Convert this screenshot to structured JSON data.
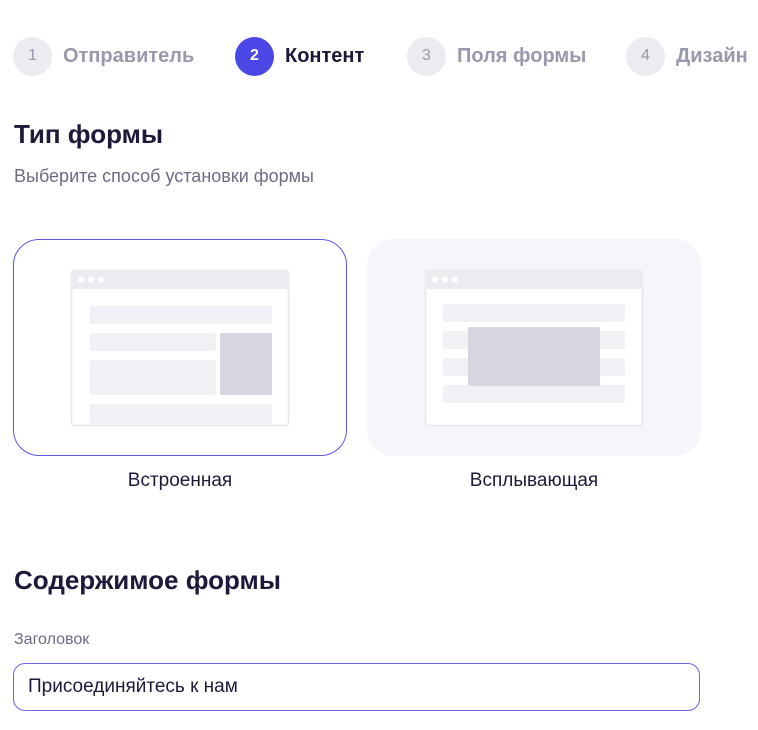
{
  "steps": [
    {
      "number": "1",
      "label": "Отправитель"
    },
    {
      "number": "2",
      "label": "Контент"
    },
    {
      "number": "3",
      "label": "Поля формы"
    },
    {
      "number": "4",
      "label": "Дизайн"
    }
  ],
  "active_step": 2,
  "form_type": {
    "title": "Тип формы",
    "subtitle": "Выберите способ установки формы",
    "options": [
      {
        "label": "Встроенная",
        "selected": true,
        "illustration": "embedded-form-icon"
      },
      {
        "label": "Всплывающая",
        "selected": false,
        "illustration": "popup-form-icon"
      }
    ]
  },
  "form_content": {
    "title": "Содержимое формы",
    "heading_label": "Заголовок",
    "heading_value": "Присоединяйтесь к нам"
  },
  "colors": {
    "accent": "#4b46e6",
    "text_primary": "#1b1a3a",
    "text_muted": "#9999ad",
    "card_selected_border": "#5b55e8"
  }
}
